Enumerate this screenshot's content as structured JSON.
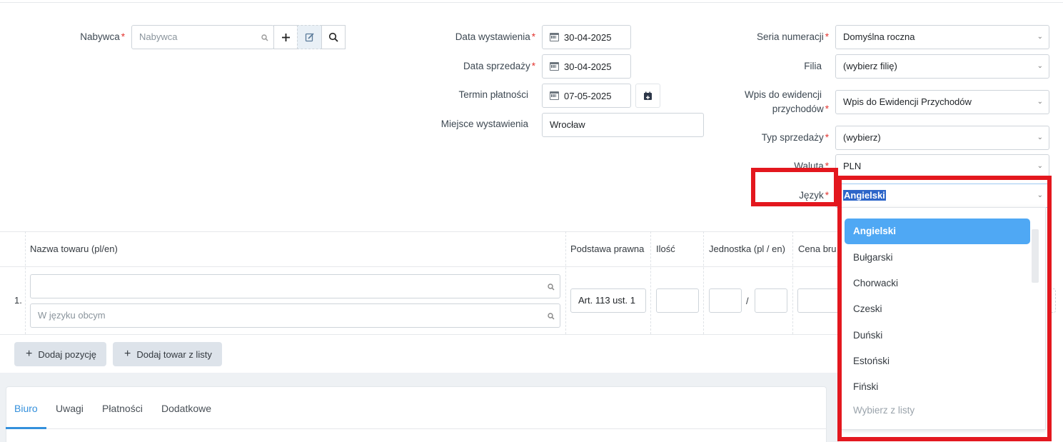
{
  "buyer": {
    "label": "Nabywca",
    "placeholder": "Nabywca"
  },
  "dates": {
    "issue_label": "Data wystawienia",
    "issue_value": "30-04-2025",
    "sale_label": "Data sprzedaży",
    "sale_value": "30-04-2025",
    "payment_label": "Termin płatności",
    "payment_value": "07-05-2025",
    "place_label": "Miejsce wystawienia",
    "place_value": "Wrocław"
  },
  "right": {
    "series_label": "Seria numeracji",
    "series_value": "Domyślna roczna",
    "branch_label": "Filia",
    "branch_value": "(wybierz filię)",
    "ledger_label_1": "Wpis do ewidencji",
    "ledger_label_2": "przychodów",
    "ledger_value": "Wpis do Ewidencji Przychodów",
    "sale_type_label": "Typ sprzedaży",
    "sale_type_value": "(wybierz)",
    "currency_label": "Waluta",
    "currency_value": "PLN",
    "language_label": "Język",
    "language_value": "Angielski"
  },
  "required_mark": "*",
  "table": {
    "headers": {
      "name": "Nazwa towaru (pl/en)",
      "legal": "Podstawa prawna",
      "qty": "Ilość",
      "unit": "Jednostka (pl / en)",
      "price": "Cena bru"
    },
    "row_number": "1.",
    "foreign_placeholder": "W języku obcym",
    "legal_value": "Art. 113 ust. 1",
    "unit_sep": "/"
  },
  "actions": {
    "plus": "+",
    "add_position": "Dodaj pozycję",
    "add_from_list": "Dodaj towar z listy"
  },
  "tabs": [
    "Biuro",
    "Uwagi",
    "Płatności",
    "Dodatkowe"
  ],
  "dropdown": {
    "options": [
      "Angielski",
      "Bułgarski",
      "Chorwacki",
      "Czeski",
      "Duński",
      "Estoński",
      "Fiński"
    ],
    "selected": "Angielski",
    "hint": "Wybierz z listy"
  },
  "colors": {
    "accent": "#3490dc",
    "highlight": "#e3171e",
    "selected_option": "#4fa8f4"
  },
  "icons": [
    "search-icon",
    "plus-icon",
    "edit-icon",
    "calendar-icon",
    "calendar-add-icon",
    "chevron-down-icon"
  ]
}
